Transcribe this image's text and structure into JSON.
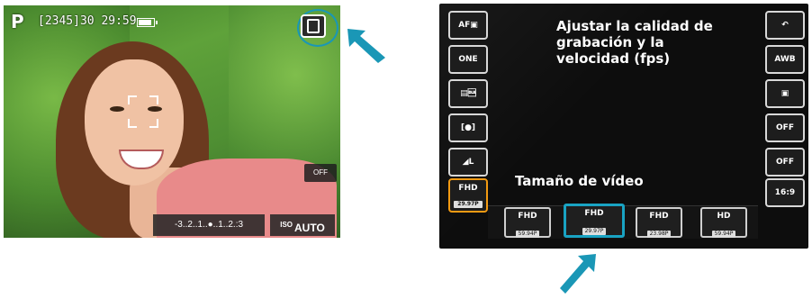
{
  "left_camera": {
    "mode": "P",
    "shots_remaining": "[2345]",
    "recording_time": "30 29:59",
    "q_button_label": "Q",
    "exposure_scale": "-3..2..1..●..1..2.:3",
    "iso_label": "ISO",
    "iso_value": "AUTO",
    "flash_label": "OFF"
  },
  "right_camera": {
    "info_title": "Ajustar la calidad de grabación y la velocidad (fps)",
    "setting_label": "Tamaño de vídeo",
    "left_menu": [
      {
        "label": "AF▣"
      },
      {
        "label": "ONE SHOT"
      },
      {
        "label": "▤\u0010"
      },
      {
        "label": "[●]"
      },
      {
        "label": "◢L"
      },
      {
        "label": "FHD",
        "sub": "29.97P"
      }
    ],
    "right_menu": [
      {
        "label": "↶"
      },
      {
        "label": "AWB"
      },
      {
        "label": "▣"
      },
      {
        "label": "OFF"
      },
      {
        "label": "OFF"
      },
      {
        "label": "16:9"
      }
    ],
    "options": [
      {
        "format": "FHD",
        "rate": "59.94P"
      },
      {
        "format": "FHD",
        "rate": "29.97P"
      },
      {
        "format": "FHD",
        "rate": "23.98P"
      },
      {
        "format": "HD",
        "rate": "59.94P"
      }
    ]
  },
  "colors": {
    "highlight": "#19a3c3",
    "active_menu": "#f29a12"
  }
}
